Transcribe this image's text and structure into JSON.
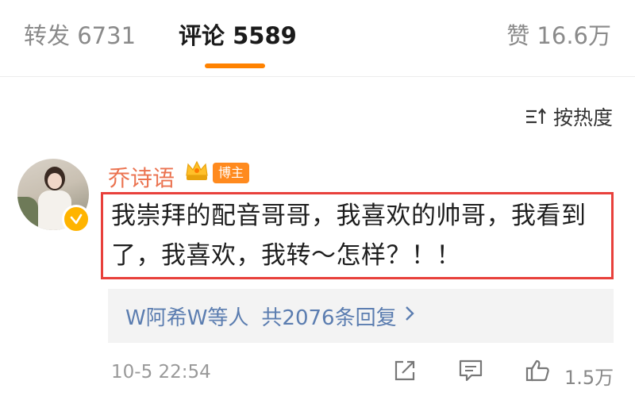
{
  "tabs": {
    "repost": "转发 6731",
    "comments": "评论 5589",
    "likes": "赞 16.6万"
  },
  "sort": {
    "label": "按热度"
  },
  "comment": {
    "username": "乔诗语",
    "badge": "博主",
    "text_line1": "我崇拜的配音哥哥，我喜欢的帅哥，我看到",
    "text_line2": "了，我喜欢，我转～怎样？！！",
    "replies_by": "W阿希W等人",
    "replies_count": "共2076条回复",
    "timestamp": "10-5 22:54",
    "like_count": "1.5万"
  },
  "colors": {
    "accent": "#ff8200",
    "username": "#eb7350",
    "highlight_border": "#e8403b",
    "link": "#5b7db0",
    "verified": "#ffb400"
  },
  "icons": [
    "sort-icon",
    "crown-icon",
    "verified-icon",
    "chevron-right-icon",
    "share-icon",
    "comment-icon",
    "like-icon"
  ]
}
